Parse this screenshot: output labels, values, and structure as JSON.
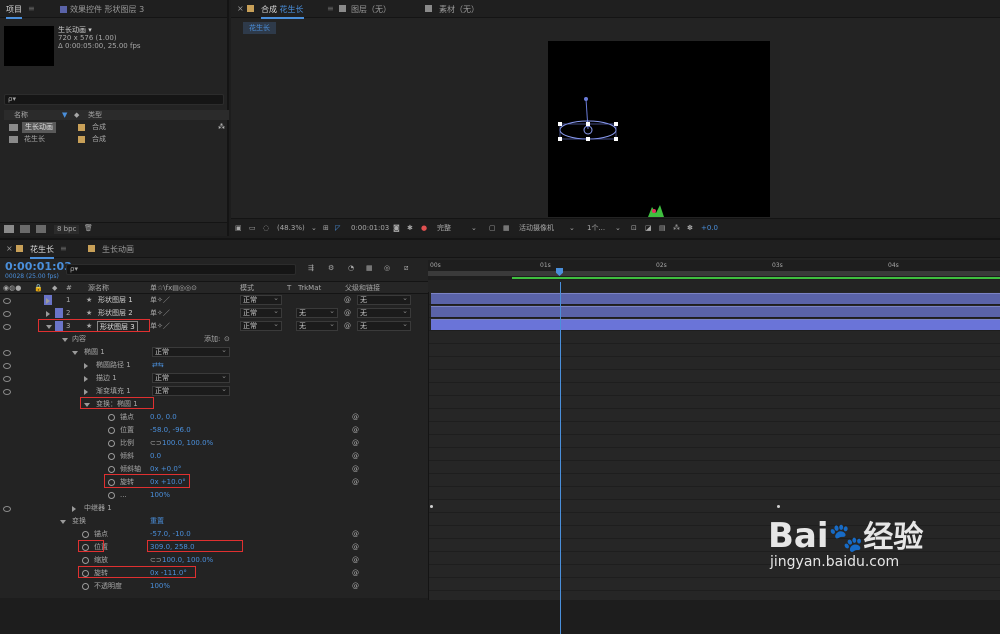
{
  "project_panel": {
    "tab_label": "项目",
    "effects_tab_label": "效果控件 形状图层 3",
    "comp_name": "生长动画 ▾",
    "comp_size": "720 x 576 (1.00)",
    "comp_duration": "Δ 0:00:05:00, 25.00 fps",
    "search_placeholder": "ρ▾",
    "col_name": "名称",
    "col_type": "类型",
    "items": [
      {
        "name": "生长动画",
        "type": "合成"
      },
      {
        "name": "花生长",
        "type": "合成"
      }
    ],
    "bpc_label": "8 bpc"
  },
  "comp_panel": {
    "tab_label": "合成",
    "tab_comp_name": "花生长",
    "layer_tab": "图层（无）",
    "footage_tab": "素材（无）",
    "flow_label": "花生长",
    "zoom": "(48.3%)",
    "timecode": "0:00:01:03",
    "resolution": "完整",
    "camera": "活动摄像机",
    "views": "1个...",
    "exposure": "+0.0"
  },
  "timeline": {
    "tab1": "花生长",
    "tab2": "生长动画",
    "current_time": "0:00:01:03",
    "frame_info": "00028 (25.00 fps)",
    "search_placeholder": "ρ▾",
    "col_num": "#",
    "col_source": "源名称",
    "col_switches": "单☆\\fx▤◎◎⊙",
    "col_mode": "模式",
    "col_t": "T",
    "col_trkmat": "TrkMat",
    "col_parent": "父级和链接",
    "ruler": [
      "00s",
      "01s",
      "02s",
      "03s",
      "04s"
    ],
    "layers": [
      {
        "num": "1",
        "name": "形状图层 1",
        "mode": "正常",
        "trkmat": "",
        "parent": "无"
      },
      {
        "num": "2",
        "name": "形状图层 2",
        "mode": "正常",
        "trkmat": "无",
        "parent": "无"
      },
      {
        "num": "3",
        "name": "形状图层 3",
        "mode": "正常",
        "trkmat": "无",
        "parent": "无"
      }
    ],
    "contents_label": "内容",
    "add_label": "添加:",
    "ellipse_group": "椭圆 1",
    "ellipse_group_mode": "正常",
    "ellipse_path": "椭圆路径 1",
    "stroke": "描边 1",
    "stroke_mode": "正常",
    "gradient_fill": "渐变填充 1",
    "gradient_mode": "正常",
    "transform_ellipse": "变换：椭圆 1",
    "props_inner": [
      {
        "label": "锚点",
        "value": "0.0, 0.0"
      },
      {
        "label": "位置",
        "value": "-58.0, -96.0"
      },
      {
        "label": "比例",
        "value": "100.0, 100.0%"
      },
      {
        "label": "倾斜",
        "value": "0.0"
      },
      {
        "label": "倾斜轴",
        "value": "0x +0.0°"
      },
      {
        "label": "旋转",
        "value": "0x +10.0°"
      },
      {
        "label": "...",
        "value": "100%"
      }
    ],
    "repeater": "中继器 1",
    "transform_label": "变换",
    "transform_reset": "重置",
    "props_outer": [
      {
        "label": "锚点",
        "value": "-57.0, -10.0"
      },
      {
        "label": "位置",
        "value": "309.0, 258.0"
      },
      {
        "label": "缩放",
        "value": "100.0, 100.0%"
      },
      {
        "label": "旋转",
        "value": "0x -111.0°"
      },
      {
        "label": "不透明度",
        "value": "100%"
      }
    ]
  },
  "watermark": {
    "brand": "Bai",
    "brand2": "经验",
    "url": "jingyan.baidu.com"
  },
  "colors": {
    "accent": "#4a8fdb",
    "layer_bar": "#5a63a8",
    "highlight_box": "#e03030",
    "green_marker": "#3fbf3f"
  }
}
